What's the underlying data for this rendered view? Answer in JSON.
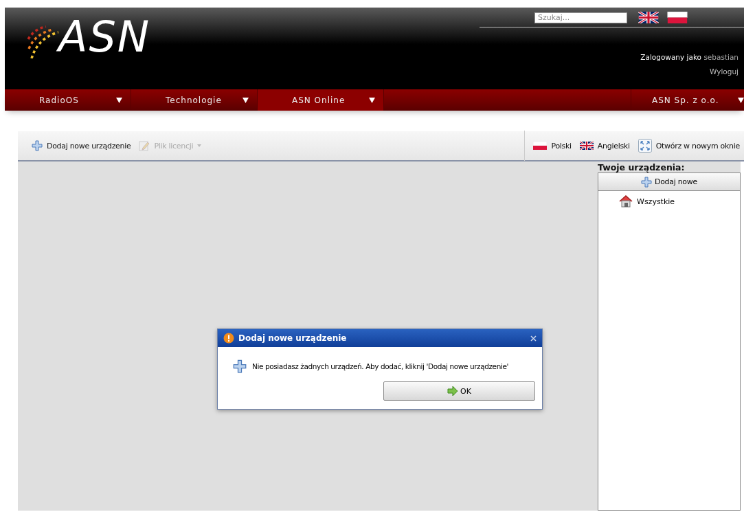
{
  "header": {
    "logo_text": "ASN",
    "search": {
      "placeholder": "Szukaj..."
    },
    "logged_in_label": "Zalogowany jako",
    "username": "sebastian",
    "logout": "Wyloguj"
  },
  "nav": {
    "items": [
      {
        "label": "RadioOS",
        "selected": false
      },
      {
        "label": "Technologie",
        "selected": false
      },
      {
        "label": "ASN Online",
        "selected": true
      }
    ],
    "right_item": {
      "label": "ASN Sp. z o.o."
    }
  },
  "toolbar": {
    "left": [
      {
        "label": "Dodaj nowe urządzenie",
        "kind": "add",
        "disabled": false
      },
      {
        "label": "Plik licencji",
        "kind": "license",
        "disabled": true
      }
    ],
    "right": [
      {
        "label": "Polski",
        "kind": "flag-pl"
      },
      {
        "label": "Angielski",
        "kind": "flag-uk"
      },
      {
        "label": "Otwórz w nowym oknie",
        "kind": "expand"
      }
    ]
  },
  "devices_panel": {
    "title": "Twoje urządzenia:",
    "add_button": "Dodaj nowe",
    "tree": [
      {
        "label": "Wszystkie"
      }
    ]
  },
  "dialog": {
    "title": "Dodaj nowe urządzenie",
    "message": "Nie posiadasz żadnych urządzeń. Aby dodać, kliknij 'Dodaj nowe urządzenie'",
    "button": "OK"
  }
}
